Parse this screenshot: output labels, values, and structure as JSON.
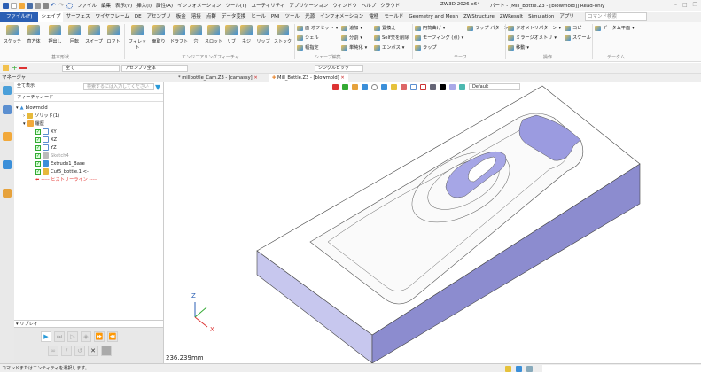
{
  "titlebar": {
    "menu": [
      "ファイル",
      "編集",
      "表示(V)",
      "挿入(I)",
      "属性(A)",
      "インフォメーション",
      "ツール(T)",
      "ユーティリティ",
      "アプリケーション",
      "ウィンドウ",
      "ヘルプ",
      "クラウド"
    ],
    "app": "ZW3D 2026 x64",
    "doc": "パート - [Mill_Bottle.Z3 - [blowmold]] Read-only"
  },
  "ribbon_tabs": [
    "ファイル(F)",
    "シェイプ",
    "サーフェス",
    "ワイヤフレーム",
    "DE",
    "アセンブリ",
    "板金",
    "溶接",
    "点群",
    "データ変換",
    "ヒール",
    "PMI",
    "ツール",
    "光源",
    "インフォメーション",
    "電極",
    "モールド",
    "Geometry and Mesh",
    "ZWStructure",
    "ZWResult",
    "Simulation",
    "アプリ"
  ],
  "active_tab": "シェイプ",
  "command_search_placeholder": "コマンド検索",
  "ribbon": {
    "basic": [
      "スケッチ",
      "直方体",
      "押出し",
      "回転",
      "スイープ",
      "ロフト"
    ],
    "eng": [
      "フィレット",
      "面取り",
      "ドラフト",
      "穴",
      "スロット",
      "リブ",
      "ネジ",
      "リップ",
      "ストック"
    ],
    "shape_edit": [
      "面 オフセット",
      "シェル",
      "幅指定",
      "追加",
      "分割",
      "単純化",
      "置換え",
      "Self交を削除",
      "エンボス"
    ],
    "morph": [
      "円筒曲げ",
      "モーフィング (点)",
      "ラップ",
      "ラップ パターン"
    ],
    "ops": [
      "ジオメトリパターン",
      "ミラージオメトリ",
      "移動",
      "コピー",
      "スケール"
    ],
    "datum": [
      "データム平面"
    ],
    "groups": [
      "基本形状",
      "エンジニアリングフィーチャ",
      "シェープ編集",
      "モーフ",
      "操作",
      "データム"
    ]
  },
  "toolbar": {
    "filter": "全て",
    "scope": "アセンブリ全体",
    "pick": "シングルピック"
  },
  "manager": {
    "title": "マネージャ",
    "show": "全て表示",
    "search_placeholder": "検索するには入力してください",
    "column": "フィーチャノード",
    "tree": [
      "blowmold",
      "ソリッド(1)",
      "履歴",
      "XY",
      "XZ",
      "YZ",
      "Sketch4",
      "Extrude1_Base",
      "Cut5_bottle.1 <-",
      "----- ヒストリーライン -----"
    ]
  },
  "doc_tabs": [
    "* millbottle_Cam.Z3 - [camassy]",
    "Mill_Bottle.Z3 - [blowmold]"
  ],
  "view_style": "Default",
  "replay": {
    "title": "リプレイ"
  },
  "axes": {
    "z": "Z",
    "x": "X"
  },
  "scale_readout": "236.239mm",
  "status": "コマンドまたはエンティティを選択します。",
  "colors": {
    "accent": "#2b5fb4",
    "model_side": "#8c8ccf",
    "model_top": "#ffffff",
    "history": "#e53935"
  }
}
